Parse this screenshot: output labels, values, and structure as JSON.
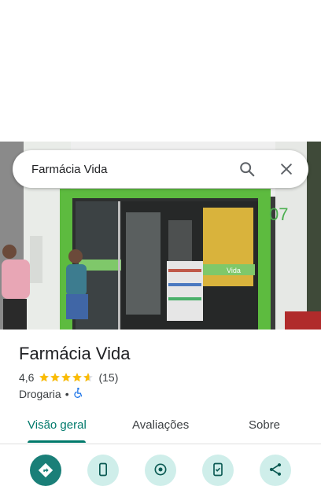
{
  "search": {
    "query": "Farmácia Vida",
    "search_icon": "search-icon",
    "close_icon": "close-icon"
  },
  "storefront": {
    "sign_text": "Vida",
    "number_fragment": "07"
  },
  "place": {
    "name": "Farmácia Vida",
    "rating": "4,6",
    "stars_value": 4.6,
    "review_count": "(15)",
    "category": "Drogaria",
    "separator": "•",
    "accessibility_icon": "wheelchair-icon"
  },
  "tabs": [
    {
      "label": "Visão geral",
      "active": true
    },
    {
      "label": "Avaliações",
      "active": false
    },
    {
      "label": "Sobre",
      "active": false
    }
  ],
  "actions": [
    {
      "icon": "directions-icon"
    },
    {
      "icon": "phone-icon"
    },
    {
      "icon": "nearby-icon"
    },
    {
      "icon": "save-icon"
    },
    {
      "icon": "share-icon"
    }
  ],
  "colors": {
    "accent": "#00796b",
    "star": "#fbbc04",
    "action_primary": "#1a7f78",
    "action_secondary": "#cfeeea",
    "storefront_green": "#5dbb3f"
  }
}
